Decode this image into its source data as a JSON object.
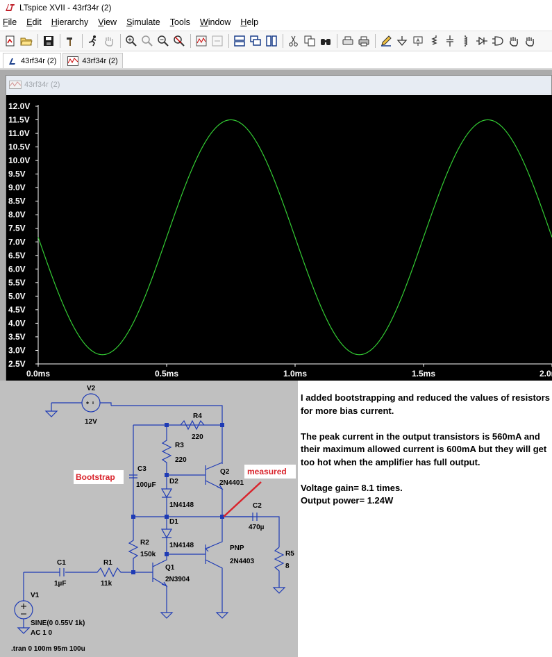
{
  "window": {
    "title": "LTspice XVII - 43rf34r (2)"
  },
  "menu": [
    {
      "label": "File",
      "u": "F",
      "rest": "ile"
    },
    {
      "label": "Edit",
      "u": "E",
      "rest": "dit"
    },
    {
      "label": "Hierarchy",
      "u": "H",
      "rest": "ierarchy"
    },
    {
      "label": "View",
      "u": "V",
      "rest": "iew"
    },
    {
      "label": "Simulate",
      "u": "S",
      "rest": "imulate"
    },
    {
      "label": "Tools",
      "u": "T",
      "rest": "ools"
    },
    {
      "label": "Window",
      "u": "W",
      "rest": "indow"
    },
    {
      "label": "Help",
      "u": "H",
      "rest": "elp"
    }
  ],
  "tabs": [
    {
      "label": "43rf34r (2)",
      "icon": "schematic-icon"
    },
    {
      "label": "43rf34r (2)",
      "icon": "waveform-icon"
    }
  ],
  "plot_window": {
    "title": "43rf34r (2)"
  },
  "chart_data": {
    "type": "line",
    "background": "#000000",
    "trace_color": "#33cc33",
    "axis_color": "#ffffff",
    "y_ticks": [
      "12.0V",
      "11.5V",
      "11.0V",
      "10.5V",
      "10.0V",
      "9.5V",
      "9.0V",
      "8.5V",
      "8.0V",
      "7.5V",
      "7.0V",
      "6.5V",
      "6.0V",
      "5.5V",
      "5.0V",
      "4.5V",
      "4.0V",
      "3.5V",
      "3.0V",
      "2.5V"
    ],
    "x_ticks": [
      "0.0ms",
      "0.5ms",
      "1.0ms",
      "1.5ms",
      "2.0ms"
    ],
    "ylim": [
      2.5,
      12.0
    ],
    "xlim": [
      0,
      2.0
    ],
    "series": [
      {
        "offset": 7.17,
        "amplitude": 4.33,
        "frequency_khz": 1.0,
        "phase": "decreasing-at-0"
      }
    ]
  },
  "schematic": {
    "V2": {
      "name": "V2",
      "value": "12V"
    },
    "R4": {
      "name": "R4",
      "value": "220"
    },
    "R3": {
      "name": "R3",
      "value": "220"
    },
    "C3": {
      "name": "C3",
      "value": "100µF"
    },
    "D2": {
      "name": "D2",
      "value": "1N4148"
    },
    "D1": {
      "name": "D1",
      "value": "1N4148"
    },
    "Q2": {
      "name": "Q2",
      "value": "2N4401"
    },
    "PNP": {
      "name": "PNP",
      "value": "2N4403"
    },
    "C2": {
      "name": "C2",
      "value": "470µ"
    },
    "R5": {
      "name": "R5",
      "value": "8"
    },
    "R2": {
      "name": "R2",
      "value": "150k"
    },
    "R1": {
      "name": "R1",
      "value": "11k"
    },
    "C1": {
      "name": "C1",
      "value": "1µF"
    },
    "Q1": {
      "name": "Q1",
      "value": "2N3904"
    },
    "V1": {
      "name": "V1",
      "line1": "SINE(0 0.55V 1k)",
      "line2": "AC 1 0"
    },
    "tran": ".tran 0 100m 95m 100u",
    "bootstrap_label": "Bootstrap",
    "measured_label": "measured",
    "annotation_color": "#d9242c"
  },
  "notes": {
    "p1": "I added bootstrapping and reduced the values of resistors for more bias current.",
    "p2": "The peak current in the output transistors is 560mA and their maximum allowed current is 600mA but they will get too hot when the amplifier has full output.",
    "p3a": "Voltage gain= 8.1 times.",
    "p3b": "Output power= 1.24W"
  }
}
